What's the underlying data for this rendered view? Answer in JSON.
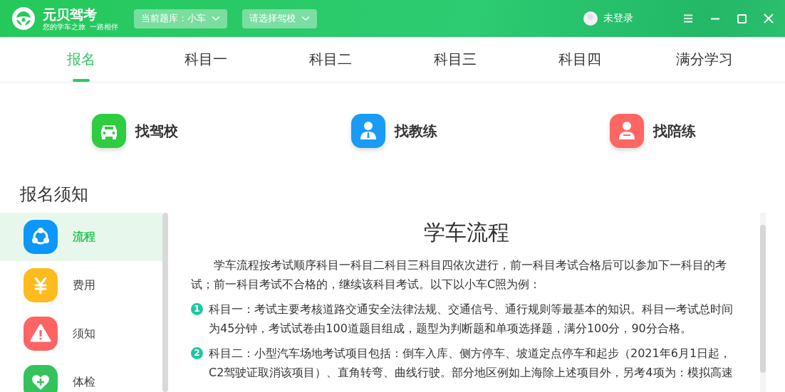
{
  "header": {
    "app_name": "元贝驾考",
    "slogan": "您的学车之旅  一路相伴",
    "dropdowns": [
      {
        "label": "当前题库：小车"
      },
      {
        "label": "请选择驾校"
      }
    ],
    "user": {
      "label": "未登录"
    }
  },
  "tabs": [
    {
      "label": "报名",
      "selected": true
    },
    {
      "label": "科目一",
      "selected": false
    },
    {
      "label": "科目二",
      "selected": false
    },
    {
      "label": "科目三",
      "selected": false
    },
    {
      "label": "科目四",
      "selected": false
    },
    {
      "label": "满分学习",
      "selected": false
    }
  ],
  "features": [
    {
      "label": "找驾校",
      "kind": "car",
      "color": "#2ecc40"
    },
    {
      "label": "找教练",
      "kind": "coach",
      "color": "#1a9bf5"
    },
    {
      "label": "找陪练",
      "kind": "partner",
      "color": "#fe6663"
    }
  ],
  "section_title": "报名须知",
  "sidebar": {
    "items": [
      {
        "label": "流程",
        "kind": "process",
        "color": "#0d96fb",
        "selected": true
      },
      {
        "label": "费用",
        "kind": "fee",
        "color": "#fdbb1e",
        "selected": false
      },
      {
        "label": "须知",
        "kind": "warning",
        "color": "#fe6463",
        "selected": false
      },
      {
        "label": "体检",
        "kind": "health",
        "color": "#33c35a",
        "selected": false
      }
    ]
  },
  "article": {
    "title": "学车流程",
    "intro": "学车流程按考试顺序科目一科目二科目三科目四依次进行，前一科目考试合格后可以参加下一科目的考试；前一科目考试不合格的，继续该科目考试。以下以小车C照为例：",
    "steps": [
      {
        "number": "1",
        "text": "科目一：考试主要考核道路交通安全法律法规、交通信号、通行规则等最基本的知识。科目一考试总时间为45分钟，考试试卷由100道题目组成，题型为判断题和单项选择题，满分100分，90分合格。"
      },
      {
        "number": "2",
        "text": "科目二：小型汽车场地考试项目包括：倒车入库、侧方停车、坡道定点停车和起步（2021年6月1日起，C2驾驶证取消该项目）、直角转弯、曲线行驶。部分地区例如上海除上述项目外，另考4项为：模拟高速"
      }
    ]
  }
}
